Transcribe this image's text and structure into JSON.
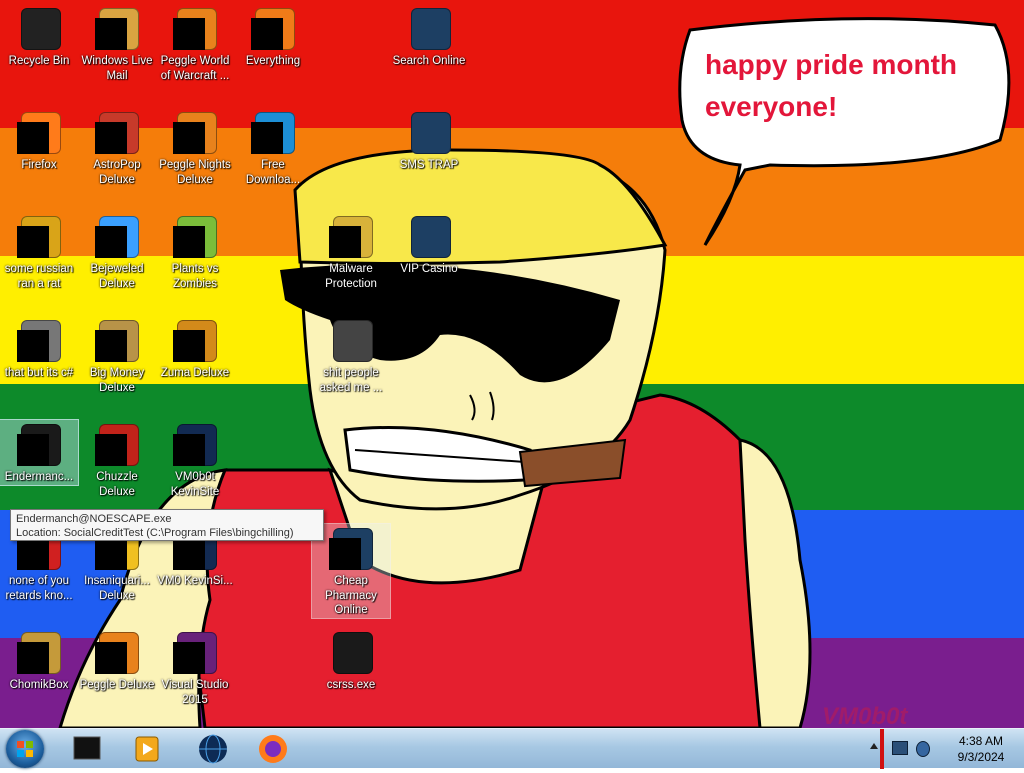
{
  "desktop": {
    "icons": [
      {
        "label": "Recycle Bin",
        "name": "recycle-bin",
        "icon": "recycle-bin-icon",
        "redacted": false
      },
      {
        "label": "Windows Live Mail",
        "name": "windows-live-mail",
        "icon": "mail-icon",
        "redacted": true
      },
      {
        "label": "Peggle World of Warcraft ...",
        "name": "peggle-wow",
        "icon": "peggle-icon",
        "redacted": true
      },
      {
        "label": "Everything",
        "name": "everything",
        "icon": "search-icon",
        "redacted": true
      },
      {
        "label": "Search Online",
        "name": "search-online",
        "icon": "window-icon",
        "redacted": false
      },
      {
        "label": "Firefox",
        "name": "firefox",
        "icon": "firefox-icon",
        "redacted": true
      },
      {
        "label": "AstroPop Deluxe",
        "name": "astropop-deluxe",
        "icon": "astropop-icon",
        "redacted": true
      },
      {
        "label": "Peggle Nights Deluxe",
        "name": "peggle-nights-deluxe",
        "icon": "peggle-icon",
        "redacted": true
      },
      {
        "label": "Free Downloa...",
        "name": "free-download",
        "icon": "download-icon",
        "redacted": true
      },
      {
        "label": "SMS TRAP",
        "name": "sms-trap",
        "icon": "window-icon",
        "redacted": false
      },
      {
        "label": "some russian ran a rat",
        "name": "some-russian-ran-a-rat",
        "icon": "ie-icon",
        "redacted": true
      },
      {
        "label": "Bejeweled Deluxe",
        "name": "bejeweled-deluxe",
        "icon": "gem-icon",
        "redacted": true
      },
      {
        "label": "Plants vs Zombies",
        "name": "plants-vs-zombies",
        "icon": "plant-icon",
        "redacted": true
      },
      {
        "label": "Malware Protection",
        "name": "malware-protection",
        "icon": "shield-icon",
        "redacted": true
      },
      {
        "label": "VIP Casino",
        "name": "vip-casino",
        "icon": "window-icon",
        "redacted": false
      },
      {
        "label": "that but its c#",
        "name": "that-but-its-csharp",
        "icon": "stack-icon",
        "redacted": true
      },
      {
        "label": "Big Money Deluxe",
        "name": "big-money-deluxe",
        "icon": "money-bag-icon",
        "redacted": true
      },
      {
        "label": "Zuma Deluxe",
        "name": "zuma-deluxe",
        "icon": "zuma-icon",
        "redacted": true
      },
      {
        "label": "shit people asked me ...",
        "name": "folder-shit-people-asked-me",
        "icon": "folder-icon",
        "redacted": false
      },
      {
        "label": "Endermanc...",
        "name": "endermanch-exe",
        "icon": "app-window-icon",
        "redacted": true
      },
      {
        "label": "Chuzzle Deluxe",
        "name": "chuzzle-deluxe",
        "icon": "chuzzle-icon",
        "redacted": true
      },
      {
        "label": "VM0b0t KevinSite",
        "name": "vm0b0t-kevinsite",
        "icon": "web-icon",
        "redacted": true
      },
      {
        "label": "none of you retards kno...",
        "name": "none-of-you",
        "icon": "record-icon",
        "redacted": true
      },
      {
        "label": "Insaniquari... Deluxe",
        "name": "insaniquarium-deluxe",
        "icon": "fish-icon",
        "redacted": true
      },
      {
        "label": "VM0 KevinSi...",
        "name": "vm0-kevinsite",
        "icon": "web-icon",
        "redacted": true
      },
      {
        "label": "Cheap Pharmacy Online",
        "name": "cheap-pharmacy-online",
        "icon": "window-icon",
        "redacted": true
      },
      {
        "label": "ChomikBox",
        "name": "chomikbox",
        "icon": "hamster-icon",
        "redacted": true
      },
      {
        "label": "Peggle Deluxe",
        "name": "peggle-deluxe",
        "icon": "peggle-icon",
        "redacted": true
      },
      {
        "label": "Visual Studio 2015",
        "name": "visual-studio-2015",
        "icon": "visual-studio-icon",
        "redacted": true
      },
      {
        "label": "csrss.exe",
        "name": "csrss-exe",
        "icon": "app-window-icon",
        "redacted": false
      }
    ]
  },
  "wallpaper": {
    "speech_line1": "happy pride month",
    "speech_line2": "everyone!",
    "signature": "VM0b0t",
    "colors": {
      "red": "#e8150d",
      "orange": "#f57d0a",
      "yellow": "#ffef00",
      "green": "#0d8a2a",
      "blue": "#1f5df2",
      "purple": "#7a1e8e",
      "skin": "#fbf3b8",
      "hair": "#f8e84a",
      "shirt": "#e51f2f",
      "text": "#e3163a"
    }
  },
  "tooltip": {
    "line1": "Endermanch@NOESCAPE.exe",
    "line2": "Location: SocialCreditTest (C:\\Program Files\\bingchilling)"
  },
  "taskbar": {
    "start_icon": "windows-orb-icon",
    "pinned": [
      {
        "name": "taskbar-black-box",
        "icon": "black-box-icon"
      },
      {
        "name": "taskbar-media-player",
        "icon": "media-player-icon"
      },
      {
        "name": "taskbar-globe",
        "icon": "globe-icon"
      },
      {
        "name": "taskbar-firefox",
        "icon": "firefox-icon"
      }
    ],
    "clock": {
      "time": "4:38 AM",
      "date": "9/3/2024"
    }
  }
}
